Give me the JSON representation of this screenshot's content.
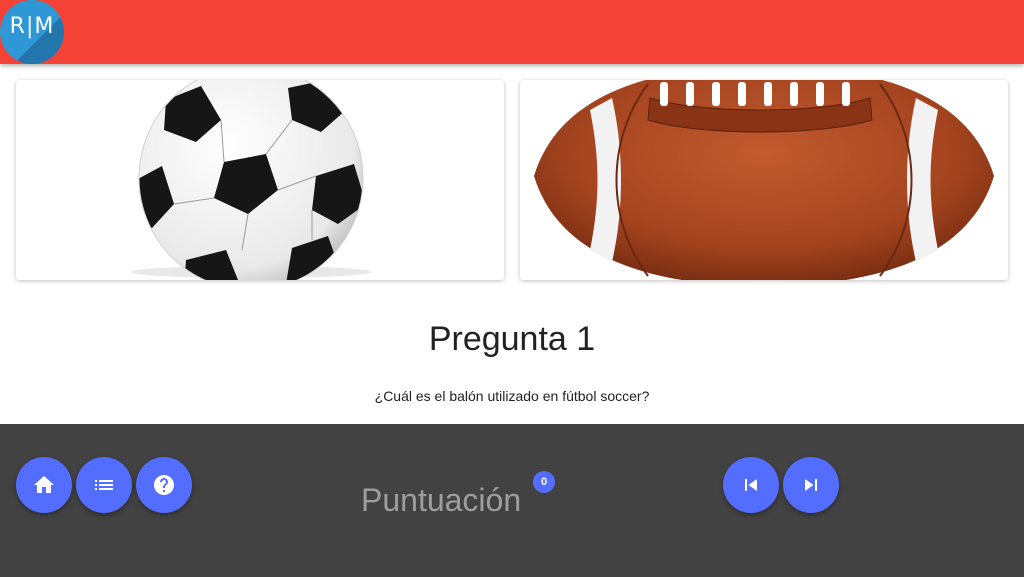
{
  "header": {
    "logo_text": "R|M",
    "bar_color": "#f44336"
  },
  "options": [
    {
      "image": "soccer-ball"
    },
    {
      "image": "american-football"
    }
  ],
  "question": {
    "title": "Pregunta 1",
    "text": "¿Cuál es el balón utilizado en fútbol soccer?"
  },
  "footer": {
    "nav_left": [
      {
        "icon": "home-icon"
      },
      {
        "icon": "list-icon"
      },
      {
        "icon": "help-icon"
      }
    ],
    "score_label": "Puntuación",
    "score_value": "0",
    "nav_right": [
      {
        "icon": "skip-previous-icon"
      },
      {
        "icon": "skip-next-icon"
      }
    ]
  },
  "colors": {
    "accent": "#536dfe",
    "footer_bg": "#424242"
  }
}
